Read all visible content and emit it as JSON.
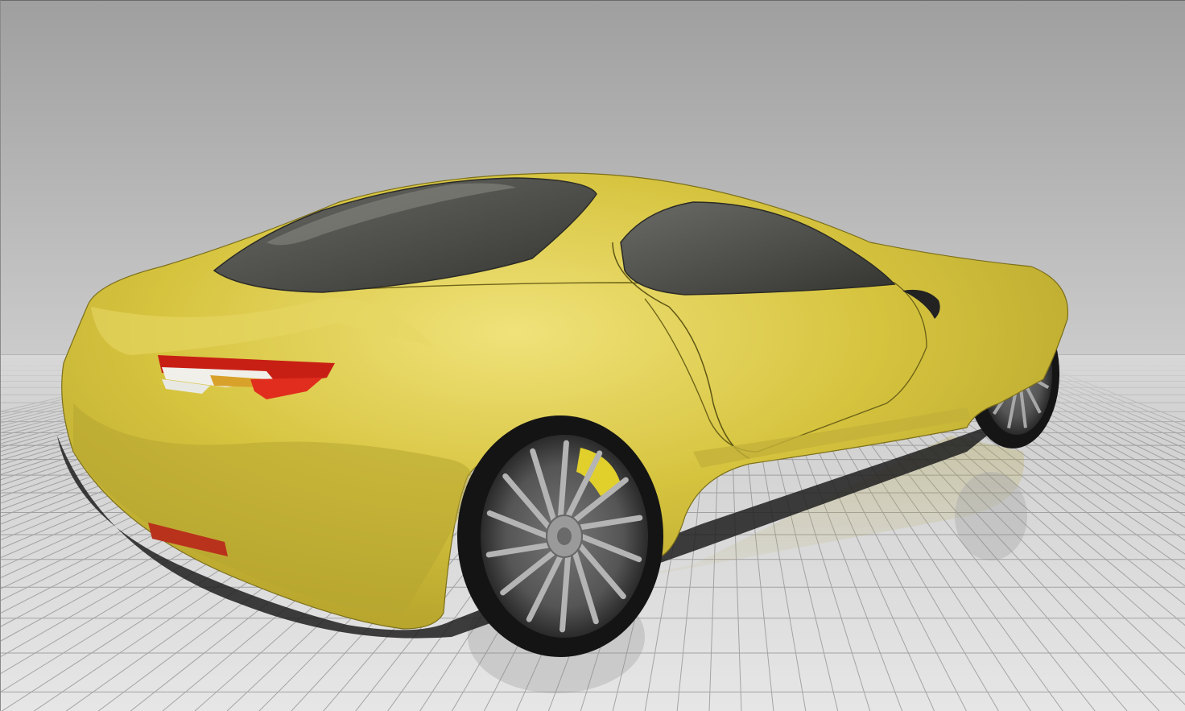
{
  "viewport": {
    "label": "",
    "background_top": "#a3a3a3",
    "background_horizon": "#cfcfcf",
    "floor_color": "#dcdcdc",
    "grid_color": "#8c8c8c"
  },
  "model": {
    "body_color": "#d4c13f",
    "body_shadow": "#8f8020",
    "glass_color": "#4a4a47",
    "tire_color": "#1a1a1a",
    "rim_color": "#9a9a9a",
    "caliper_color": "#e0cf2a",
    "taillight_color": "#d42a1e",
    "icons": [
      "car-model",
      "floor-grid"
    ]
  }
}
